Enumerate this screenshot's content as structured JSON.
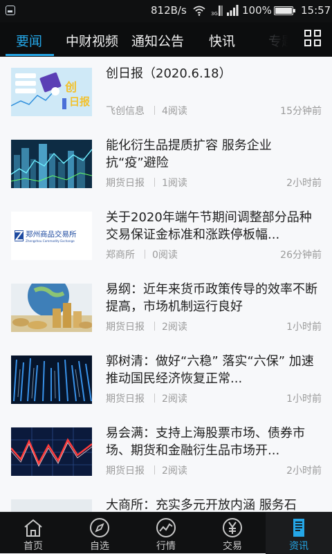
{
  "status_bar": {
    "speed": "812B/s",
    "signal_1": "₃ᴳᵗ",
    "battery_pct": "100%",
    "clock": "15:57"
  },
  "top_tabs": [
    {
      "label": "要闻",
      "active": true
    },
    {
      "label": "中财视频",
      "active": false
    },
    {
      "label": "通知公告",
      "active": false
    },
    {
      "label": "快讯",
      "active": false
    },
    {
      "label": "专题",
      "active": false
    }
  ],
  "feed": [
    {
      "title": "创日报（2020.6.18）",
      "source": "飞创信息",
      "reads": "4阅读",
      "time": "15分钟前",
      "thumb": "chuang-ribao"
    },
    {
      "title": "能化衍生品提质扩容 服务企业抗“疫”避险",
      "source": "期货日报",
      "reads": "1阅读",
      "time": "2小时前",
      "thumb": "city-chart"
    },
    {
      "title": "关于2020年端午节期间调整部分品种交易保证金标准和涨跌停板幅...",
      "source": "郑商所",
      "reads": "0阅读",
      "time": "26分钟前",
      "thumb": "zce-logo",
      "logo_cn": "郑州商品交易所",
      "logo_en": "Zhengzhou Commodity Exchange"
    },
    {
      "title": "易纲：近年来货币政策传导的效率不断提高，市场机制运行良好",
      "source": "期货日报",
      "reads": "2阅读",
      "time": "1小时前",
      "thumb": "globe-coins"
    },
    {
      "title": "郭树清：做好“六稳” 落实“六保” 加速推动国民经济恢复正常...",
      "source": "期货日报",
      "reads": "2阅读",
      "time": "1小时前",
      "thumb": "data-columns"
    },
    {
      "title": "易会满：支持上海股票市场、债券市场、期货和金融衍生品市场开...",
      "source": "期货日报",
      "reads": "2阅读",
      "time": "2小时前",
      "thumb": "red-zigzag"
    },
    {
      "title": "大商所：充实多元开放内涵 服务石",
      "source": "",
      "reads": "",
      "time": "",
      "thumb": "partial"
    }
  ],
  "bottom_nav": [
    {
      "label": "首页",
      "icon": "home-icon",
      "active": false
    },
    {
      "label": "自选",
      "icon": "compass-icon",
      "active": false
    },
    {
      "label": "行情",
      "icon": "chart-line-icon",
      "active": false
    },
    {
      "label": "交易",
      "icon": "yen-coin-icon",
      "active": false
    },
    {
      "label": "资讯",
      "icon": "news-doc-icon",
      "active": true
    }
  ],
  "colors": {
    "accent": "#25a7e8",
    "nav_bg": "#0c0d0e",
    "feed_bg": "#f7f8fa"
  }
}
